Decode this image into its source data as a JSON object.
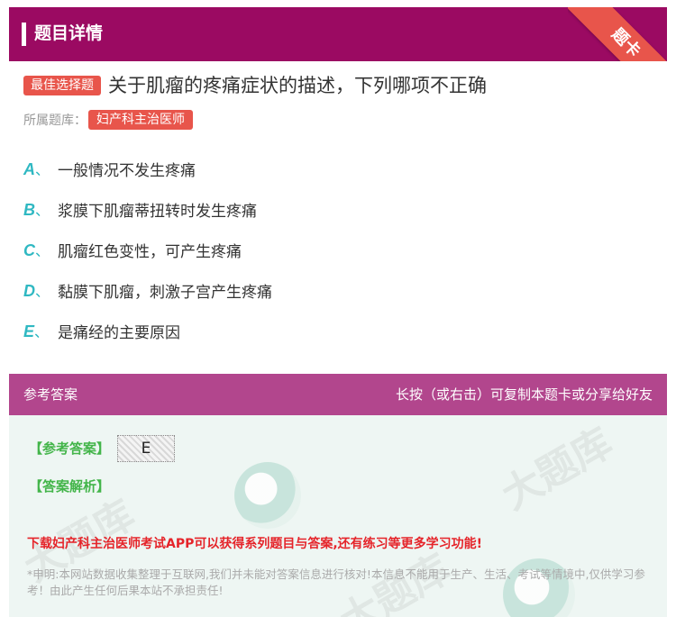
{
  "header": {
    "title": "题目详情",
    "ribbon": "题卡"
  },
  "question": {
    "type_badge": "最佳选择题",
    "text": "关于肌瘤的疼痛症状的描述，下列哪项不正确",
    "bank_label": "所属题库：",
    "bank_tag": "妇产科主治医师"
  },
  "options": [
    {
      "letter": "A",
      "sep": "、",
      "text": "一般情况不发生疼痛"
    },
    {
      "letter": "B",
      "sep": "、",
      "text": "浆膜下肌瘤蒂扭转时发生疼痛"
    },
    {
      "letter": "C",
      "sep": "、",
      "text": "肌瘤红色变性，可产生疼痛"
    },
    {
      "letter": "D",
      "sep": "、",
      "text": "黏膜下肌瘤，刺激子宫产生疼痛"
    },
    {
      "letter": "E",
      "sep": "、",
      "text": "是痛经的主要原因"
    }
  ],
  "answer_section": {
    "header_left": "参考答案",
    "header_right": "长按（或右击）可复制本题卡或分享给好友",
    "answer_label": "【参考答案】",
    "answer_value": "E",
    "analysis_label": "【答案解析】",
    "promo": "下载妇产科主治医师考试APP可以获得系列题目与答案,还有练习等更多学习功能!",
    "disclaimer": "*申明:本网站数据收集整理于互联网,我们并未能对答案信息进行核对!本信息不能用于生产、生活、考试等情境中,仅供学习参考！由此产生任何后果本站不承担责任!"
  },
  "colors": {
    "header": "#9b0a62",
    "accent": "#e8554b",
    "option_letter": "#2fb8c2",
    "answer_header": "#b2468d",
    "answer_label": "#43b54a",
    "promo": "#e5242a"
  }
}
